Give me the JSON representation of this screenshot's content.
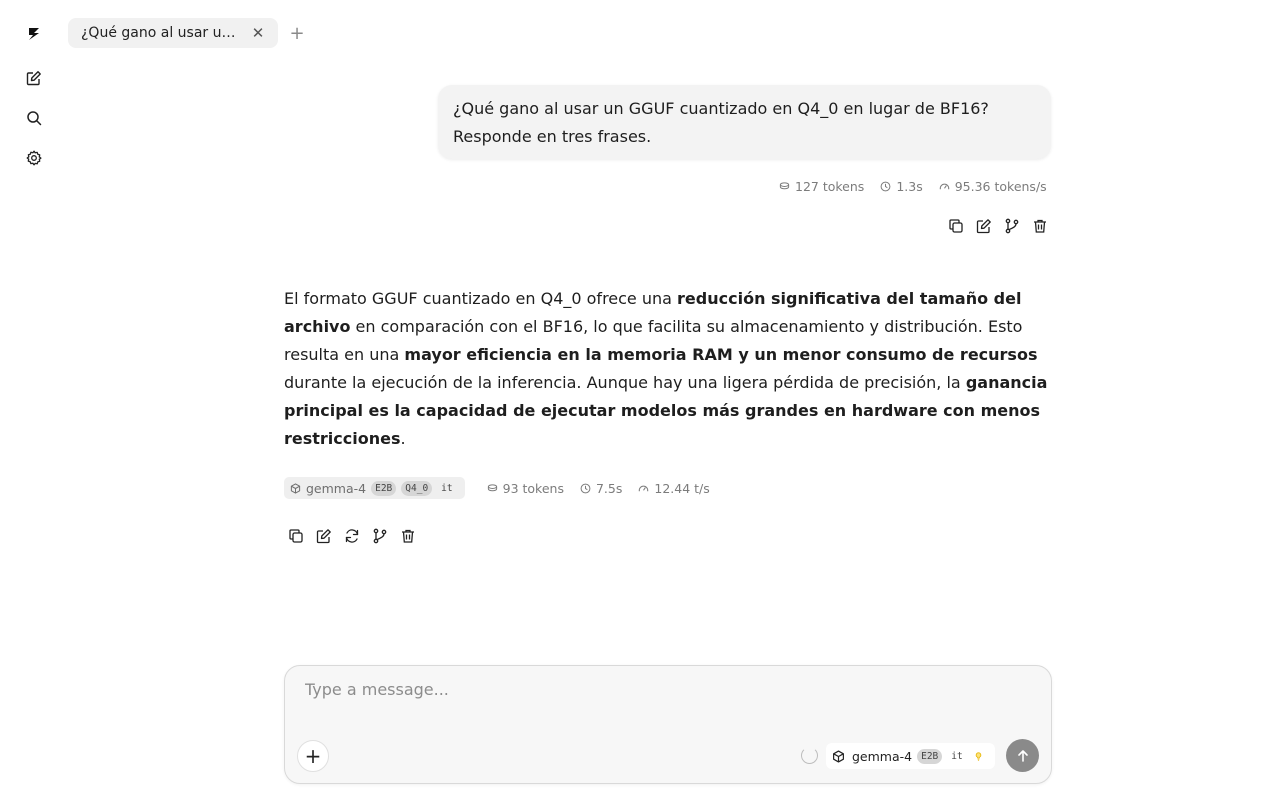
{
  "sidebar": {
    "items": [
      {
        "icon": "logo-icon"
      },
      {
        "icon": "new-chat-icon"
      },
      {
        "icon": "search-icon"
      },
      {
        "icon": "settings-icon"
      }
    ]
  },
  "tabs": [
    {
      "label": "¿Qué gano al usar un..."
    }
  ],
  "conversation": {
    "user_message": {
      "text": "¿Qué gano al usar un GGUF cuantizado en Q4_0 en lugar de BF16? Responde en tres frases.",
      "stats": {
        "tokens": "127 tokens",
        "time": "1.3s",
        "speed": "95.36 tokens/s"
      }
    },
    "assistant_message": {
      "segments": [
        {
          "text": "El formato GGUF cuantizado en Q4_0 ofrece una ",
          "bold": false
        },
        {
          "text": "reducción significativa del tamaño del archivo",
          "bold": true
        },
        {
          "text": " en comparación con el BF16, lo que facilita su almacenamiento y distribución. Esto resulta en una ",
          "bold": false
        },
        {
          "text": "mayor eficiencia en la memoria RAM y un menor consumo de recursos",
          "bold": true
        },
        {
          "text": " durante la ejecución de la inferencia. Aunque hay una ligera pérdida de precisión, la ",
          "bold": false
        },
        {
          "text": "ganancia principal es la capacidad de ejecutar modelos más grandes en hardware con menos restricciones",
          "bold": true
        },
        {
          "text": ".",
          "bold": false
        }
      ],
      "model": {
        "name": "gemma-4",
        "tags": [
          "E2B",
          "Q4_0",
          "it"
        ]
      },
      "stats": {
        "tokens": "93 tokens",
        "time": "7.5s",
        "speed": "12.44 t/s"
      }
    }
  },
  "composer": {
    "placeholder": "Type a message...",
    "model": {
      "name": "gemma-4",
      "tags": [
        "E2B",
        "it"
      ]
    }
  },
  "colors": {
    "send_button": "#8a8a8a",
    "bulb": "#f5c518",
    "chip_bg": "#efefef"
  }
}
